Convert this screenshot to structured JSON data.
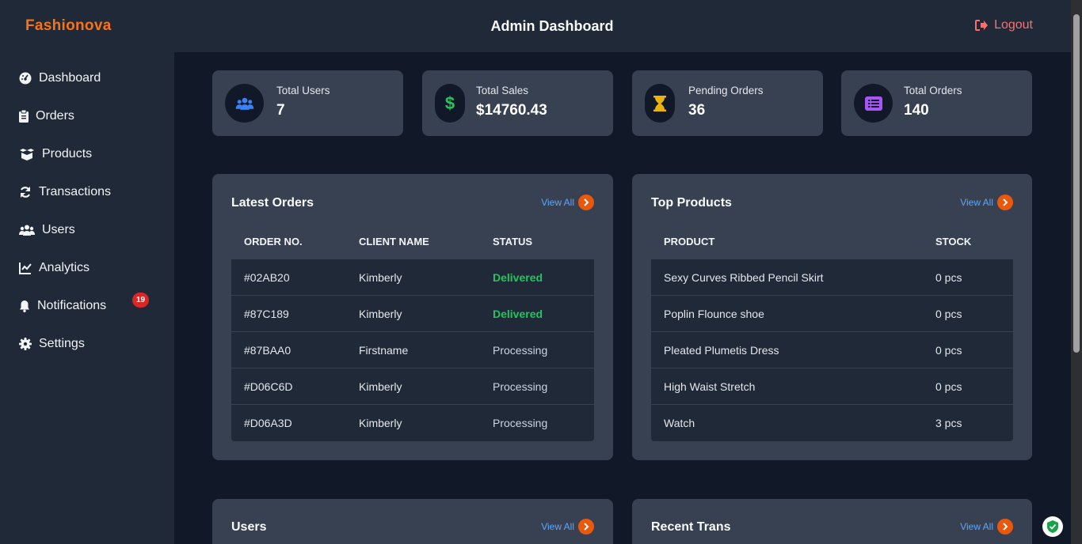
{
  "header": {
    "brand": "Fashionova",
    "title": "Admin Dashboard",
    "logout_label": "Logout"
  },
  "sidebar": {
    "items": [
      {
        "label": "Dashboard",
        "icon": "gauge-icon"
      },
      {
        "label": "Orders",
        "icon": "clipboard-icon"
      },
      {
        "label": "Products",
        "icon": "box-icon"
      },
      {
        "label": "Transactions",
        "icon": "sync-icon"
      },
      {
        "label": "Users",
        "icon": "users-icon"
      },
      {
        "label": "Analytics",
        "icon": "line-chart-icon"
      },
      {
        "label": "Notifications",
        "icon": "bell-icon"
      },
      {
        "label": "Settings",
        "icon": "gear-icon"
      }
    ],
    "notification_count": "19"
  },
  "stats": [
    {
      "label": "Total Users",
      "value": "7",
      "icon": "users-icon",
      "icon_color": "#3b82f6"
    },
    {
      "label": "Total Sales",
      "value": "$14760.43",
      "icon": "dollar-icon",
      "icon_color": "#22c55e"
    },
    {
      "label": "Pending Orders",
      "value": "36",
      "icon": "hourglass-icon",
      "icon_color": "#eab308"
    },
    {
      "label": "Total Orders",
      "value": "140",
      "icon": "list-icon",
      "icon_color": "#a855f7"
    }
  ],
  "latest_orders": {
    "title": "Latest Orders",
    "view_all": "View All",
    "columns": [
      "ORDER NO.",
      "CLIENT NAME",
      "STATUS"
    ],
    "rows": [
      {
        "order": "#02AB20",
        "client": "Kimberly",
        "status": "Delivered"
      },
      {
        "order": "#87C189",
        "client": "Kimberly",
        "status": "Delivered"
      },
      {
        "order": "#87BAA0",
        "client": "Firstname",
        "status": "Processing"
      },
      {
        "order": "#D06C6D",
        "client": "Kimberly",
        "status": "Processing"
      },
      {
        "order": "#D06A3D",
        "client": "Kimberly",
        "status": "Processing"
      }
    ]
  },
  "top_products": {
    "title": "Top Products",
    "view_all": "View All",
    "columns": [
      "PRODUCT",
      "STOCK"
    ],
    "rows": [
      {
        "product": "Sexy Curves Ribbed Pencil Skirt",
        "stock": "0 pcs"
      },
      {
        "product": "Poplin Flounce shoe",
        "stock": "0 pcs"
      },
      {
        "product": "Pleated Plumetis Dress",
        "stock": "0 pcs"
      },
      {
        "product": "High Waist Stretch",
        "stock": "0 pcs"
      },
      {
        "product": "Watch",
        "stock": "3 pcs"
      }
    ]
  },
  "users_panel": {
    "title": "Users",
    "view_all": "View All"
  },
  "recent_trans_panel": {
    "title": "Recent Trans",
    "view_all": "View All"
  },
  "colors": {
    "accent": "#f97316",
    "delivered": "#22c55e",
    "link": "#60a5fa",
    "danger": "#f87171"
  }
}
